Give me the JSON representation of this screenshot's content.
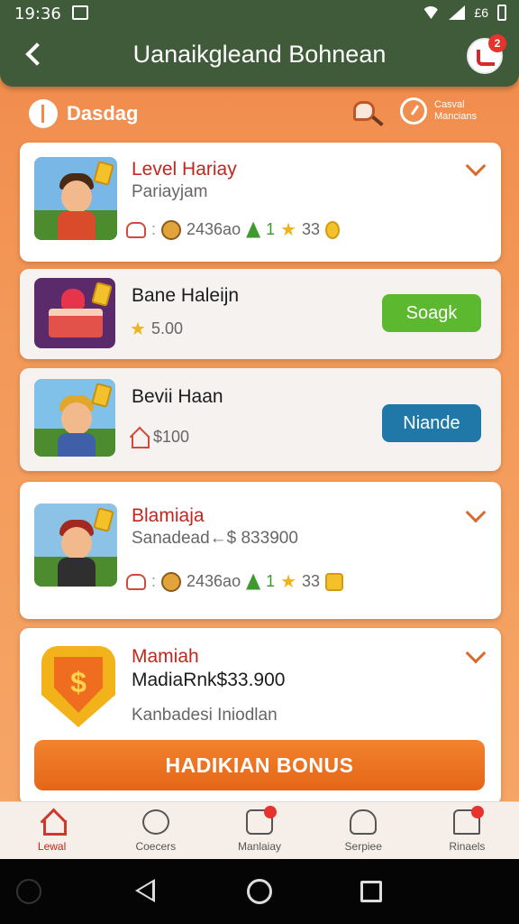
{
  "status_bar": {
    "time": "19:36",
    "network": "£6"
  },
  "header": {
    "title": "Uanaikgleand Bohnean",
    "avatar_badge": "2"
  },
  "subheader": {
    "label": "Dasdag",
    "right_line1": "Casval",
    "right_line2": "Mancians"
  },
  "cards": [
    {
      "title": "Level Hariay",
      "subtitle": "Pariayjam",
      "stat_value": "2436ao",
      "stat_a": "1",
      "stat_b": "33"
    },
    {
      "title": "Bane Haleijn",
      "price": "5.00",
      "button": "Soagk"
    },
    {
      "title": "Bevii Haan",
      "price": "$100",
      "button": "Niande"
    },
    {
      "title": "Blamiaja",
      "subtitle": "Sanadead←$ 833900",
      "stat_value": "2436ao",
      "stat_a": "1",
      "stat_b": "33"
    },
    {
      "title": "Mamiah",
      "subtitle": "MadiaRnk$33.900",
      "note": "Kanbadesi Iniodlan",
      "button": "HADIKIAN BONUS"
    }
  ],
  "bottom_nav": [
    {
      "label": "Lewal",
      "icon": "home-icon",
      "active": true
    },
    {
      "label": "Coecers",
      "icon": "chat-bubble-icon"
    },
    {
      "label": "Manlaiay",
      "icon": "game-box-icon",
      "badge": ""
    },
    {
      "label": "Serpiee",
      "icon": "shell-icon"
    },
    {
      "label": "Rinaels",
      "icon": "profile-icon",
      "badge": ""
    }
  ],
  "colors": {
    "header_bg": "#3f5b3a",
    "accent_orange": "#e46617",
    "title_red": "#c2261f",
    "button_green": "#5cb82e",
    "button_blue": "#1f78a8"
  }
}
